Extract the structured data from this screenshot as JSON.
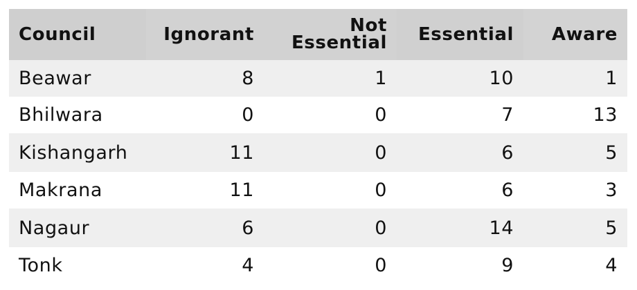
{
  "chart_data": {
    "type": "table",
    "columns": [
      "Council",
      "Ignorant",
      "Not Essential",
      "Essential",
      "Aware"
    ],
    "header_lines": {
      "council": [
        "Council"
      ],
      "ignorant": [
        "Ignorant"
      ],
      "not_essential": [
        "Not",
        "Essential"
      ],
      "essential": [
        "Essential"
      ],
      "aware": [
        "Aware"
      ]
    },
    "rows": [
      {
        "council": "Beawar",
        "ignorant": 8,
        "not_essential": 1,
        "essential": 10,
        "aware": 1
      },
      {
        "council": "Bhilwara",
        "ignorant": 0,
        "not_essential": 0,
        "essential": 7,
        "aware": 13
      },
      {
        "council": "Kishangarh",
        "ignorant": 11,
        "not_essential": 0,
        "essential": 6,
        "aware": 5
      },
      {
        "council": "Makrana",
        "ignorant": 11,
        "not_essential": 0,
        "essential": 6,
        "aware": 3
      },
      {
        "council": "Nagaur",
        "ignorant": 6,
        "not_essential": 0,
        "essential": 14,
        "aware": 5
      },
      {
        "council": "Tonk",
        "ignorant": 4,
        "not_essential": 0,
        "essential": 9,
        "aware": 4
      }
    ],
    "colors": {
      "header_bg": "#d0d0d0",
      "stripe_bg": "#efefef",
      "row_bg": "#ffffff",
      "text": "#111111"
    }
  }
}
